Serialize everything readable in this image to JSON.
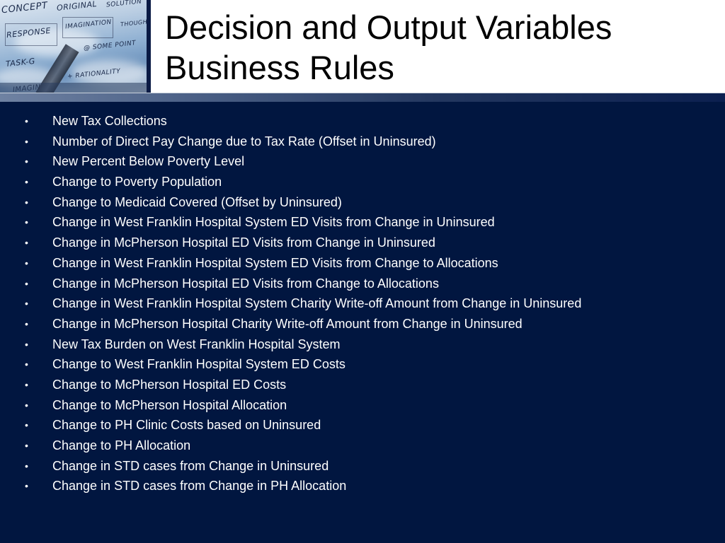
{
  "slide": {
    "title_line1": "Decision and Output Variables",
    "title_line2": "Business Rules",
    "header_image": {
      "icon": "handwritten-concepts-photo",
      "scrawled_words": [
        "CONCEPT",
        "ORIGINAL",
        "SOLUTION",
        "RESPONSE",
        "IMAGINATION",
        "THOUGHT",
        "TASK-G",
        "@ SOME POINT",
        "+ RATIONALITY",
        "IMAGIN"
      ]
    },
    "bullet_glyph": "•",
    "bullets": [
      "New Tax Collections",
      "Number of Direct Pay Change due to Tax Rate (Offset in Uninsured)",
      "New Percent Below Poverty Level",
      "Change to Poverty Population",
      "Change to Medicaid Covered (Offset by Uninsured)",
      "Change in West Franklin Hospital System ED Visits from Change in Uninsured",
      "Change in McPherson Hospital ED Visits from Change in Uninsured",
      "Change in West Franklin Hospital System ED Visits from Change to Allocations",
      "Change in McPherson Hospital ED Visits from Change to Allocations",
      "Change in West Franklin Hospital System Charity Write-off Amount from Change in Uninsured",
      "Change in McPherson Hospital Charity Write-off Amount from Change in Uninsured",
      "New Tax Burden on West Franklin Hospital System",
      "Change to West Franklin Hospital System ED Costs",
      "Change to McPherson Hospital ED Costs",
      "Change to McPherson Hospital Allocation",
      "Change to PH Clinic Costs based on Uninsured",
      "Change to PH Allocation",
      "Change in STD cases from Change in Uninsured",
      "Change in STD cases from Change in PH Allocation"
    ]
  },
  "colors": {
    "background": "#011640",
    "title_background": "#ffffff",
    "title_text": "#000000",
    "bullet_text": "#ffffff"
  }
}
